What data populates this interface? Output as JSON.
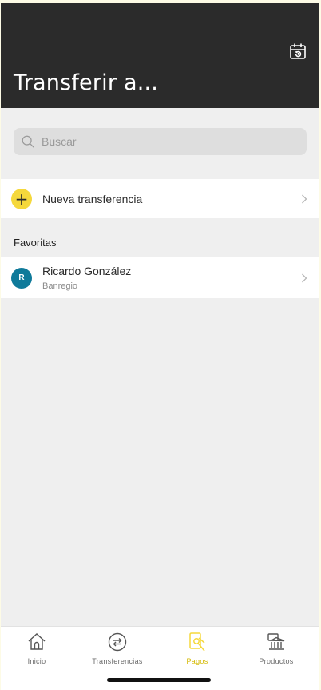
{
  "header": {
    "title": "Transferir a...",
    "calendar_icon": "calendar-history-icon"
  },
  "search": {
    "placeholder": "Buscar"
  },
  "new_transfer": {
    "label": "Nueva transferencia",
    "icon": "plus-icon"
  },
  "favorites": {
    "section_label": "Favoritas",
    "items": [
      {
        "initial": "R",
        "name": "Ricardo González",
        "bank": "Banregio"
      }
    ]
  },
  "tabbar": {
    "tabs": [
      {
        "label": "Inicio",
        "icon": "home-icon",
        "active": false
      },
      {
        "label": "Transferencias",
        "icon": "transfer-icon",
        "active": false
      },
      {
        "label": "Pagos",
        "icon": "payments-icon",
        "active": true
      },
      {
        "label": "Productos",
        "icon": "bank-icon",
        "active": false
      }
    ],
    "active_color": "#f5d83c"
  },
  "colors": {
    "header_bg": "#2b2b2b",
    "accent": "#f5d83c",
    "avatar": "#0f7a9a"
  }
}
